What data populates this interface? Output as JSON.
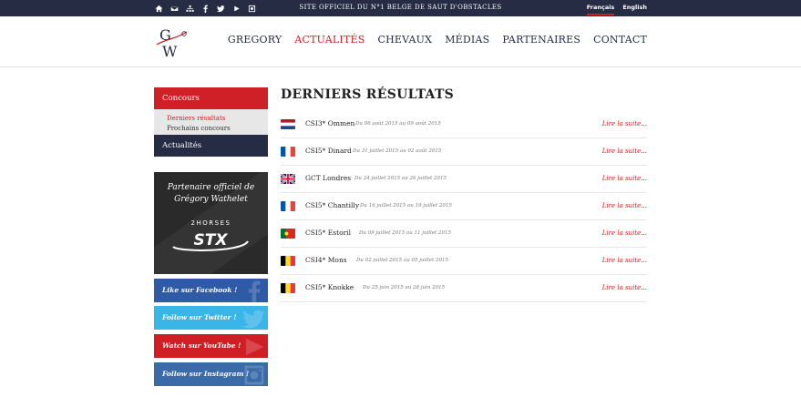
{
  "topbar": {
    "icons": [
      "home-icon",
      "mail-icon",
      "sitemap-icon",
      "facebook-icon",
      "twitter-icon",
      "youtube-icon",
      "instagram-icon"
    ],
    "tagline": "SITE OFFICIEL DU N°1 BELGE DE SAUT D'OBSTACLES",
    "languages": [
      {
        "label": "Français",
        "active": true
      },
      {
        "label": "English",
        "active": false
      }
    ]
  },
  "header": {
    "logo_letters": "GW",
    "nav": [
      {
        "label": "GREGORY",
        "active": false
      },
      {
        "label": "ACTUALITÉS",
        "active": true
      },
      {
        "label": "CHEVAUX",
        "active": false
      },
      {
        "label": "MÉDIAS",
        "active": false
      },
      {
        "label": "PARTENAIRES",
        "active": false
      },
      {
        "label": "CONTACT",
        "active": false
      }
    ]
  },
  "sidebar": {
    "section_label": "Concours",
    "sub_items": [
      {
        "label": "Derniers résultats",
        "active": true
      },
      {
        "label": "Prochains concours",
        "active": false
      }
    ],
    "secondary_label": "Actualités",
    "partner": {
      "line1": "Partenaire officiel de",
      "line2": "Grégory Wathelet",
      "brand_top": "2HORSES",
      "brand_main": "STX"
    },
    "social": {
      "facebook": "Like sur Facebook !",
      "twitter": "Follow sur Twitter !",
      "youtube": "Watch sur YouTube !",
      "instagram": "Follow sur Instagram !"
    }
  },
  "main": {
    "title": "DERNIERS RÉSULTATS",
    "read_more": "Lire la suite...",
    "results": [
      {
        "event": "CSI3* Ommen",
        "dates": "Du 06 août 2015 au 09 août 2015",
        "flag": "netherlands"
      },
      {
        "event": "CSI5* Dinard",
        "dates": "Du 31 juillet 2015 au 02 août 2015",
        "flag": "france"
      },
      {
        "event": "GCT Londres",
        "dates": "Du 24 juillet 2015 au 26 juillet 2015",
        "flag": "united-kingdom"
      },
      {
        "event": "CSI5* Chantilly",
        "dates": "Du 16 juillet 2015 au 19 juillet 2015",
        "flag": "france"
      },
      {
        "event": "CSI5* Estoril",
        "dates": "Du 09 juillet 2015 au 11 juillet 2015",
        "flag": "portugal"
      },
      {
        "event": "CSI4* Mons",
        "dates": "Du 02 juillet 2015 au 05 juillet 2015",
        "flag": "belgium"
      },
      {
        "event": "CSI5* Knokke",
        "dates": "Du 25 juin 2015 au 28 juin 2015",
        "flag": "belgium"
      }
    ]
  },
  "colors": {
    "navy": "#252c43",
    "accent_red": "#cf2027",
    "facebook": "#2f5aa6",
    "twitter": "#3ab5e8",
    "youtube": "#d01e25",
    "instagram": "#3b6aa8"
  }
}
